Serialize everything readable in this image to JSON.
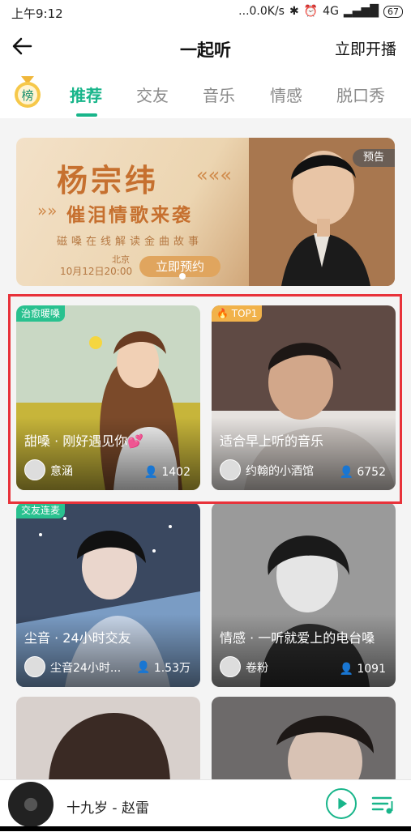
{
  "status_bar": {
    "time": "上午9:12",
    "network": "...0.0K/s",
    "signal": "4G",
    "battery": "67"
  },
  "header": {
    "title": "一起听",
    "start_broadcast": "立即开播"
  },
  "tabs": {
    "rank_badge": "榜",
    "items": [
      {
        "label": "推荐"
      },
      {
        "label": "交友"
      },
      {
        "label": "音乐"
      },
      {
        "label": "情感"
      },
      {
        "label": "脱口秀"
      }
    ]
  },
  "banner": {
    "name": "杨宗纬",
    "subtitle": "催泪情歌来袭",
    "description": "磁嗓在线解读金曲故事",
    "location": "北京",
    "date": "10月12日20:00",
    "reserve_label": "立即预约",
    "tag": "预告"
  },
  "cards": [
    {
      "label": "治愈暖嗓",
      "title": "甜嗓 · 刚好遇见你💕",
      "host": "意涵",
      "count": "1402"
    },
    {
      "label": "TOP1",
      "title": "适合早上听的音乐",
      "host": "约翰的小酒馆",
      "count": "6752"
    },
    {
      "label": "交友连麦",
      "title": "尘音 · 24小时交友",
      "host": "尘音24小时...",
      "count": "1.53万"
    },
    {
      "label": "",
      "title": "情感 · 一听就爱上的电台嗓",
      "host": "卷粉",
      "count": "1091"
    }
  ],
  "player": {
    "song": "十九岁 - 赵雷"
  },
  "colors": {
    "accent": "#18b58a",
    "highlight_box": "#e8323a"
  }
}
